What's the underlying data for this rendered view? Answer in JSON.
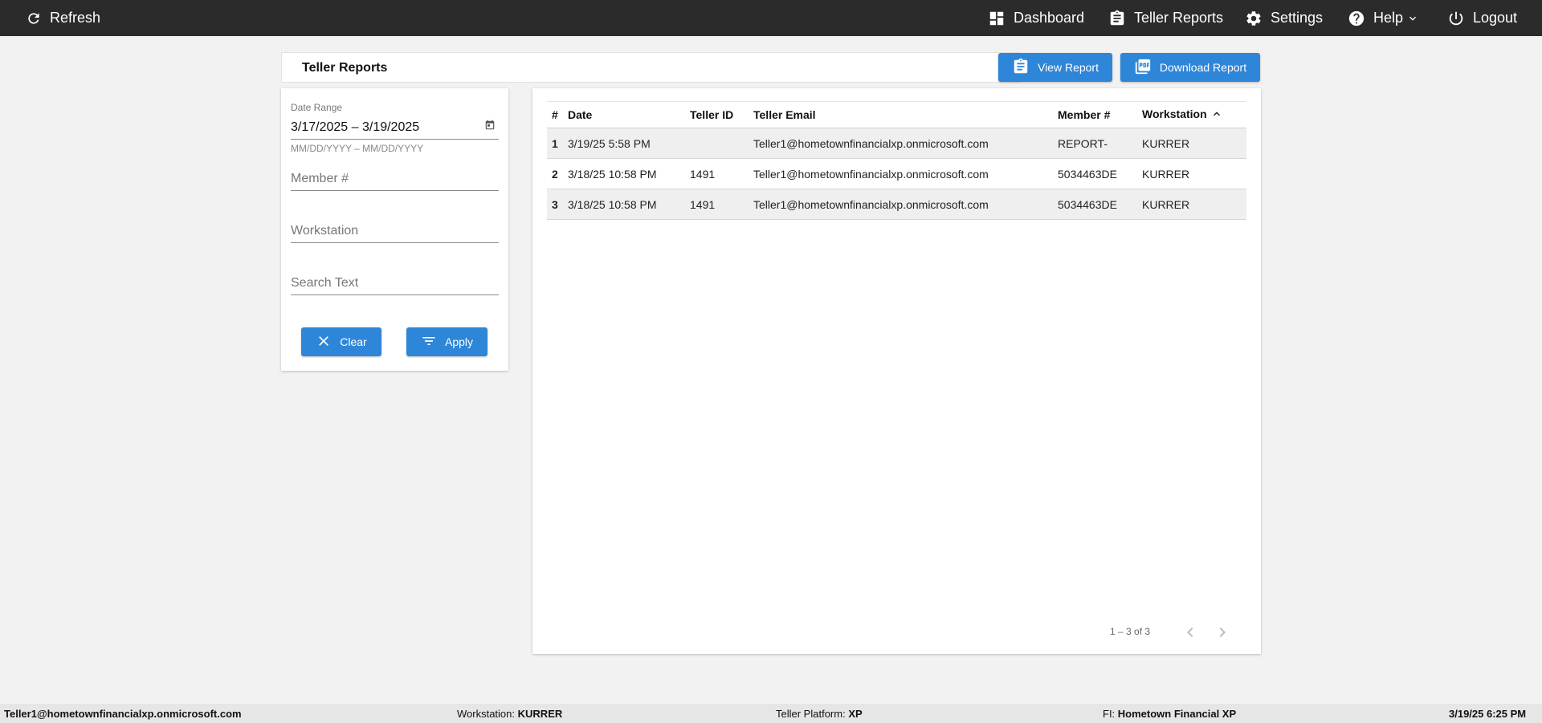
{
  "topbar": {
    "refresh_label": "Refresh",
    "nav": {
      "dashboard": "Dashboard",
      "teller_reports": "Teller Reports",
      "settings": "Settings",
      "help": "Help",
      "logout": "Logout"
    }
  },
  "header": {
    "title": "Teller Reports",
    "view_report_label": "View Report",
    "download_report_label": "Download Report"
  },
  "filters": {
    "date_range_label": "Date Range",
    "date_range_value": "3/17/2025 – 3/19/2025",
    "date_range_hint": "MM/DD/YYYY – MM/DD/YYYY",
    "member_placeholder": "Member #",
    "workstation_placeholder": "Workstation",
    "search_placeholder": "Search Text",
    "clear_label": "Clear",
    "apply_label": "Apply"
  },
  "table": {
    "columns": [
      "#",
      "Date",
      "Teller ID",
      "Teller Email",
      "Member #",
      "Workstation"
    ],
    "rows": [
      [
        "1",
        "3/19/25 5:58 PM",
        "",
        "Teller1@hometownfinancialxp.onmicrosoft.com",
        "REPORT-",
        "KURRER"
      ],
      [
        "2",
        "3/18/25 10:58 PM",
        "1491",
        "Teller1@hometownfinancialxp.onmicrosoft.com",
        "5034463DE",
        "KURRER"
      ],
      [
        "3",
        "3/18/25 10:58 PM",
        "1491",
        "Teller1@hometownfinancialxp.onmicrosoft.com",
        "5034463DE",
        "KURRER"
      ]
    ],
    "sort_column": "Workstation",
    "sort_direction": "asc",
    "pagination": "1 – 3 of 3"
  },
  "footer": {
    "user_email": "Teller1@hometownfinancialxp.onmicrosoft.com",
    "workstation_label": "Workstation:",
    "workstation_value": "KURRER",
    "platform_label": "Teller Platform:",
    "platform_value": "XP",
    "fi_label": "FI:",
    "fi_value": "Hometown Financial XP",
    "datetime": "3/19/25 6:25 PM"
  },
  "colors": {
    "topbar": "#2b2b2b",
    "accent": "#2e86d9",
    "background": "#f2f2f2"
  }
}
